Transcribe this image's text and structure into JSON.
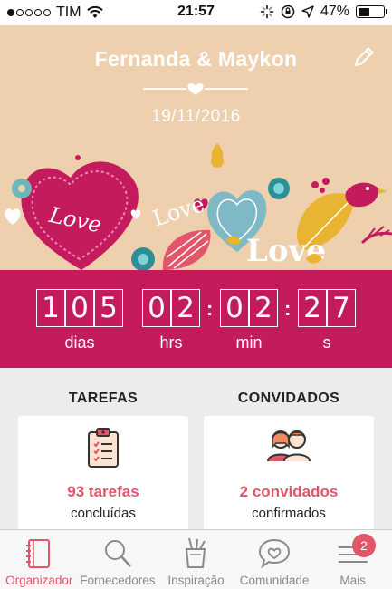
{
  "status_bar": {
    "carrier": "TIM",
    "time": "21:57",
    "battery_percent": "47%",
    "battery_level": 0.47,
    "signal_dots_filled": 1,
    "signal_dots_total": 5
  },
  "header": {
    "couple_names": "Fernanda & Maykon",
    "wedding_date": "19/11/2016",
    "edit_icon": "pencil-icon",
    "background_color": "#eecfae"
  },
  "countdown": {
    "days": "105",
    "hours": "02",
    "minutes": "02",
    "seconds": "27",
    "labels": {
      "days": "dias",
      "hours": "hrs",
      "minutes": "min",
      "seconds": "s"
    },
    "color": "#c41a5e"
  },
  "sections": {
    "tasks": {
      "title": "TAREFAS",
      "value": "93 tarefas",
      "subtitle": "concluídas",
      "icon": "clipboard-checklist-icon"
    },
    "guests": {
      "title": "CONVIDADOS",
      "value": "2 convidados",
      "subtitle": "confirmados",
      "icon": "couple-avatars-icon"
    }
  },
  "tabs": [
    {
      "label": "Organizador",
      "icon": "notebook-icon",
      "active": true
    },
    {
      "label": "Fornecedores",
      "icon": "search-icon",
      "active": false
    },
    {
      "label": "Inspiração",
      "icon": "brush-cup-icon",
      "active": false
    },
    {
      "label": "Comunidade",
      "icon": "heart-chat-icon",
      "active": false
    },
    {
      "label": "Mais",
      "icon": "menu-icon",
      "active": false,
      "badge": "2"
    }
  ],
  "colors": {
    "accent": "#e2566a",
    "countdown_bg": "#c41a5e",
    "header_bg": "#eecfae"
  }
}
